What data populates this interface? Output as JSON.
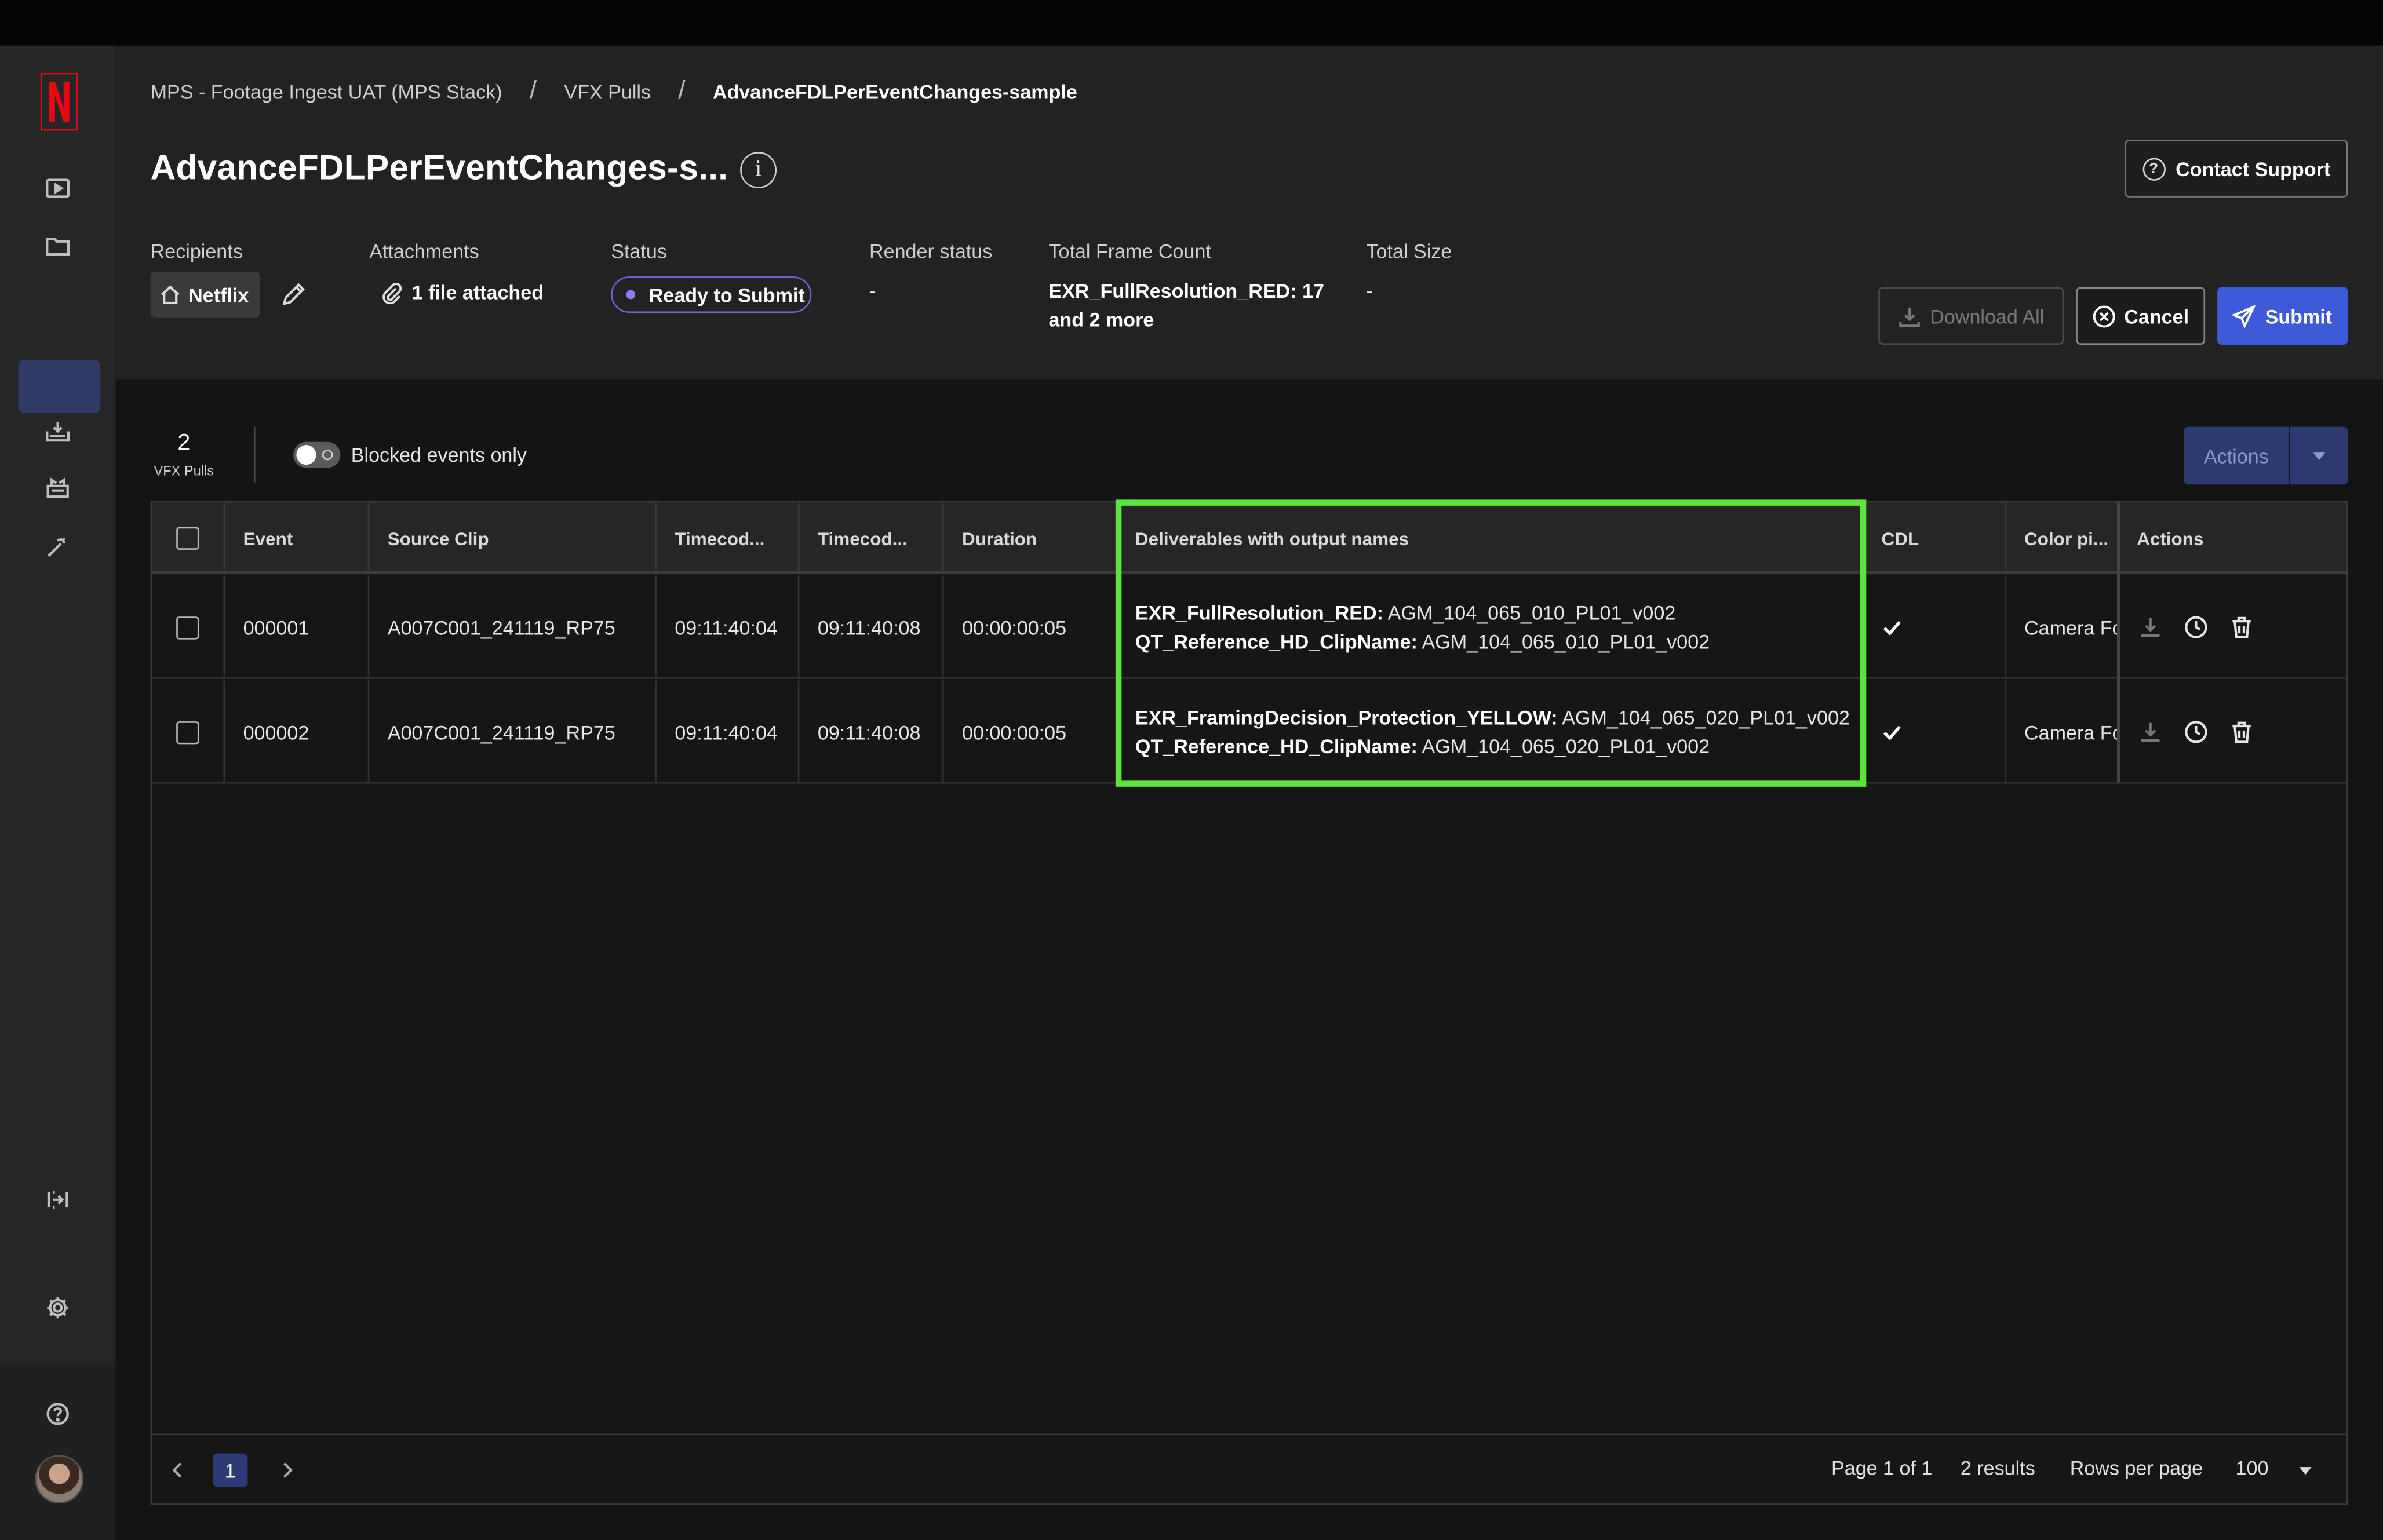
{
  "breadcrumb": {
    "items": [
      "MPS - Footage Ingest UAT (MPS Stack)",
      "VFX Pulls"
    ],
    "current": "AdvanceFDLPerEventChanges-sample",
    "separator": "/"
  },
  "page": {
    "title": "AdvanceFDLPerEventChanges-s...",
    "info_glyph": "i"
  },
  "contact_support": {
    "label": "Contact Support",
    "icon": "question-circle-icon"
  },
  "meta": {
    "recipients_label": "Recipients",
    "recipient_chip": "Netflix",
    "attachments_label": "Attachments",
    "attachments_value": "1 file attached",
    "status_label": "Status",
    "status_value": "Ready to Submit",
    "render_status_label": "Render status",
    "render_status_value": "-",
    "total_frame_count_label": "Total Frame Count",
    "total_frame_count_line1": "EXR_FullResolution_RED: 17",
    "total_frame_count_line2": "and 2 more",
    "total_size_label": "Total Size",
    "total_size_value": "-"
  },
  "buttons": {
    "download_all": "Download All",
    "cancel": "Cancel",
    "submit": "Submit",
    "actions": "Actions"
  },
  "summary": {
    "count": "2",
    "count_label": "VFX Pulls",
    "toggle_label": "Blocked events only",
    "toggle_on": false
  },
  "table": {
    "headers": [
      "Event",
      "Source Clip",
      "Timecod...",
      "Timecod...",
      "Duration",
      "Deliverables with output names",
      "CDL",
      "Color pi...",
      "Actions"
    ],
    "rows": [
      {
        "event": "000001",
        "source_clip": "A007C001_241119_RP75",
        "tc_in": "09:11:40:04",
        "tc_out": "09:11:40:08",
        "duration": "00:00:00:05",
        "deliv1_name": "EXR_FullResolution_RED:",
        "deliv1_value": "AGM_104_065_010_PL01_v002",
        "deliv2_name": "QT_Reference_HD_ClipName:",
        "deliv2_value": "AGM_104_065_010_PL01_v002",
        "cdl": true,
        "color_pipeline": "Camera Fo"
      },
      {
        "event": "000002",
        "source_clip": "A007C001_241119_RP75",
        "tc_in": "09:11:40:04",
        "tc_out": "09:11:40:08",
        "duration": "00:00:00:05",
        "deliv1_name": "EXR_FramingDecision_Protection_YELLOW:",
        "deliv1_value": "AGM_104_065_020_PL01_v002",
        "deliv2_name": "QT_Reference_HD_ClipName:",
        "deliv2_value": "AGM_104_065_020_PL01_v002",
        "cdl": true,
        "color_pipeline": "Camera Fo"
      }
    ]
  },
  "pagination": {
    "current_page": "1",
    "page_info": "Page 1 of 1",
    "results": "2 results",
    "rows_per_page_label": "Rows per page",
    "rows_per_page_value": "100"
  },
  "sidebar": {
    "icons": [
      "netflix-logo",
      "play-icon",
      "folder-icon",
      "film-icon",
      "ingest-icon",
      "pull-icon",
      "magic-wand-icon",
      "expand-icon",
      "gear-icon",
      "help-icon",
      "avatar"
    ]
  },
  "colors": {
    "accent": "#3d5bd9",
    "highlight": "#5ce53c",
    "status_border": "#6b63d6",
    "active_nav": "#2f3b66"
  }
}
